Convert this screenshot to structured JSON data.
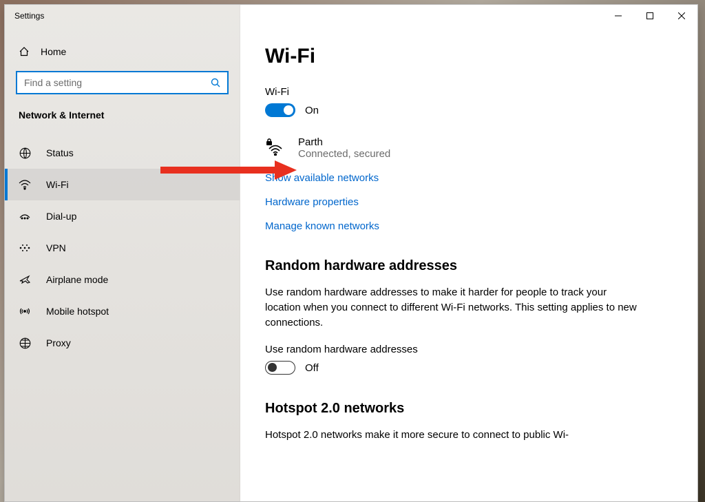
{
  "window": {
    "title": "Settings"
  },
  "sidebar": {
    "home_label": "Home",
    "search_placeholder": "Find a setting",
    "category": "Network & Internet",
    "items": [
      {
        "label": "Status"
      },
      {
        "label": "Wi-Fi"
      },
      {
        "label": "Dial-up"
      },
      {
        "label": "VPN"
      },
      {
        "label": "Airplane mode"
      },
      {
        "label": "Mobile hotspot"
      },
      {
        "label": "Proxy"
      }
    ]
  },
  "main": {
    "title": "Wi-Fi",
    "wifi_toggle_label": "Wi-Fi",
    "wifi_toggle_state": "On",
    "current_network": {
      "name": "Parth",
      "status": "Connected, secured"
    },
    "links": {
      "show_available": "Show available networks",
      "hardware_props": "Hardware properties",
      "manage_known": "Manage known networks"
    },
    "random_hw": {
      "heading": "Random hardware addresses",
      "body": "Use random hardware addresses to make it harder for people to track your location when you connect to different Wi-Fi networks. This setting applies to new connections.",
      "toggle_label": "Use random hardware addresses",
      "toggle_state": "Off"
    },
    "hotspot2": {
      "heading": "Hotspot 2.0 networks",
      "body": "Hotspot 2.0 networks make it more secure to connect to public Wi-"
    }
  }
}
